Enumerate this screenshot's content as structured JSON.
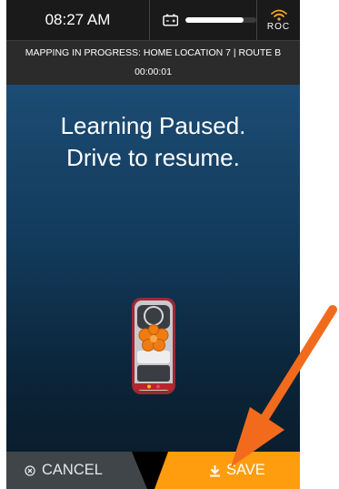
{
  "status_bar": {
    "time": "08:27 AM",
    "battery_icon": "battery-icon",
    "battery_level": 0.82,
    "signal_icon": "wifi-signal-icon",
    "signal_label": "ROC"
  },
  "mapping_bar": {
    "status": "MAPPING IN PROGRESS: HOME LOCATION 7 | ROUTE B",
    "elapsed": "00:00:01"
  },
  "main": {
    "headline_line1": "Learning Paused.",
    "headline_line2": "Drive to resume."
  },
  "actions": {
    "cancel_label": "CANCEL",
    "cancel_icon": "cancel-circle-icon",
    "save_label": "SAVE",
    "save_icon": "download-icon"
  },
  "colors": {
    "save_accent": "#ff9d0f",
    "signal_accent": "#f5a623",
    "annotation_arrow": "#f26b1d",
    "background_top": "#1c4c74",
    "background_bottom": "#0a1e2e"
  }
}
